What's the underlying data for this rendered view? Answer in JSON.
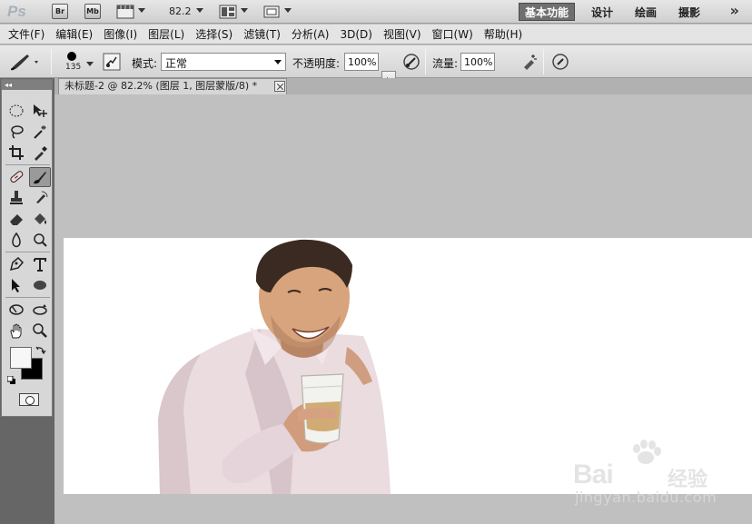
{
  "app_bar": {
    "logo_text": "Ps",
    "bridge_label": "Br",
    "minibridge_label": "Mb",
    "zoom_level": "82.2",
    "workspaces": [
      "基本功能",
      "设计",
      "绘画",
      "摄影"
    ],
    "active_workspace": "基本功能",
    "more_symbol": "»"
  },
  "menu": [
    "文件(F)",
    "编辑(E)",
    "图像(I)",
    "图层(L)",
    "选择(S)",
    "滤镜(T)",
    "分析(A)",
    "3D(D)",
    "视图(V)",
    "窗口(W)",
    "帮助(H)"
  ],
  "options": {
    "brush_size": "135",
    "mode_label": "模式:",
    "mode_value": "正常",
    "opacity_label": "不透明度:",
    "opacity_value": "100%",
    "flow_label": "流量:",
    "flow_value": "100%"
  },
  "toolbox": {
    "collapse_symbol": "◂◂",
    "tools": [
      "rectangular-marquee",
      "move",
      "lasso",
      "magic-wand",
      "crop",
      "eyedropper",
      "healing-brush",
      "brush",
      "clone-stamp",
      "history-brush",
      "eraser",
      "paint-bucket",
      "blur",
      "dodge",
      "pen",
      "type",
      "path-selection",
      "ellipse-shape",
      "3d-rotate",
      "3d-orbit",
      "hand",
      "zoom"
    ],
    "active_tool": "brush",
    "foreground_color": "#f7f7f7",
    "background_color": "#000000"
  },
  "document": {
    "tab_title": "未标题-2 @ 82.2% (图层 1, 图层蒙版/8) *"
  },
  "colors": {
    "workspace_bg": "#c0c0c0",
    "active_workspace_bg": "#6f6f6f",
    "toolbox_bg": "#d7d7d7"
  },
  "watermark": {
    "brand": "Bai",
    "brand_cn": "经验",
    "url": "jingyan.baidu.com"
  }
}
